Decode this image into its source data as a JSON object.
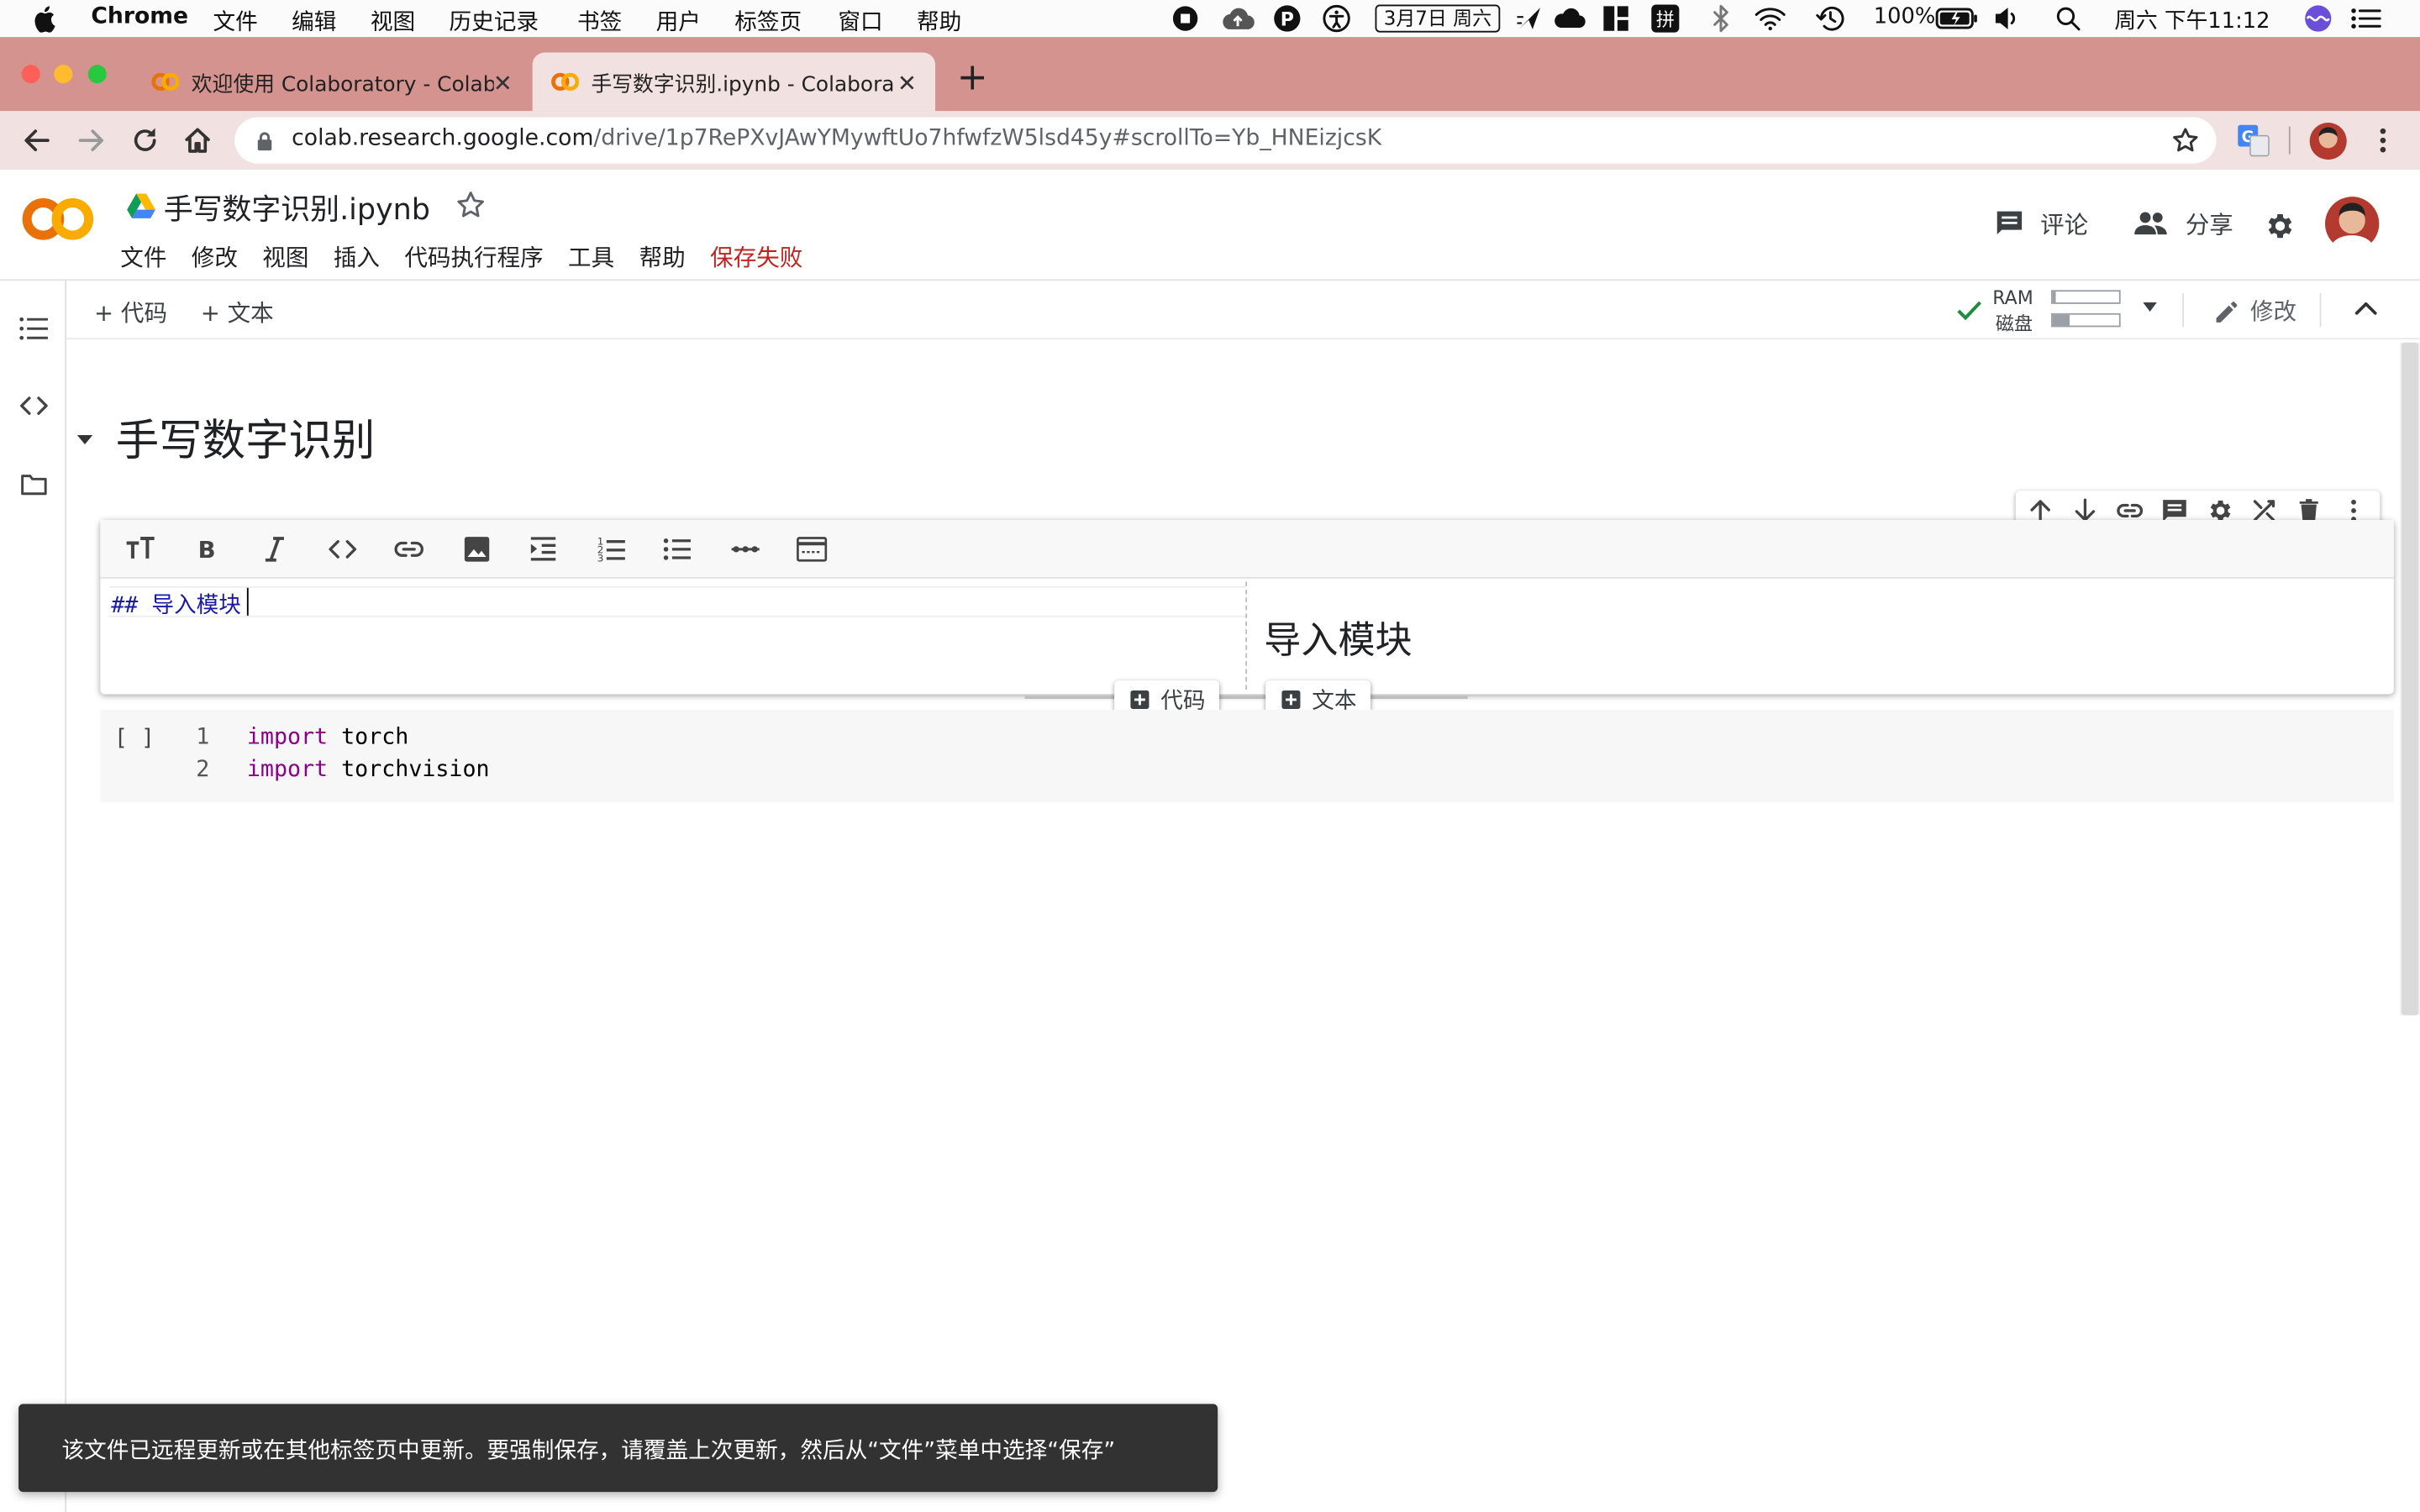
{
  "macos_menubar": {
    "app_name": "Chrome",
    "menus": [
      "文件",
      "编辑",
      "视图",
      "历史记录",
      "书签",
      "用户",
      "标签页",
      "窗口",
      "帮助"
    ],
    "date_badge": "3月7日 周六",
    "battery": "100%",
    "clock": "周六 下午11:12"
  },
  "browser": {
    "tabs": [
      {
        "title": "欢迎使用 Colaboratory - Colabor",
        "active": false
      },
      {
        "title": "手写数字识别.ipynb - Colaborato",
        "active": true
      }
    ],
    "new_tab_symbol": "+",
    "url_host": "colab.research.google.com",
    "url_path": "/drive/1p7RePXvJAwYMywftUo7hfwfzW5lsd45y#scrollTo=Yb_HNEizjcsK"
  },
  "colab": {
    "logo_text": "CO",
    "notebook_title": "手写数字识别.ipynb",
    "menus": [
      "文件",
      "修改",
      "视图",
      "插入",
      "代码执行程序",
      "工具",
      "帮助"
    ],
    "save_status": "保存失败",
    "comment_label": "评论",
    "share_label": "分享",
    "add_code_label": "代码",
    "add_text_label": "文本",
    "ram_label": "RAM",
    "disk_label": "磁盘",
    "edit_label": "修改",
    "ram_fraction": 0.05,
    "disk_fraction": 0.25
  },
  "notebook": {
    "section_title": "手写数字识别",
    "text_cell": {
      "markdown_source": "## 导入模块",
      "preview_heading": "导入模块"
    },
    "inserter": {
      "code_label": "代码",
      "text_label": "文本"
    },
    "code_cell": {
      "run_indicator": "[ ]",
      "lines": [
        {
          "num": "1",
          "keyword": "import",
          "rest": "torch"
        },
        {
          "num": "2",
          "keyword": "import",
          "rest": "torchvision"
        }
      ]
    }
  },
  "toast": {
    "message": "该文件已远程更新或在其他标签页中更新。要强制保存，请覆盖上次更新，然后从“文件”菜单中选择“保存”"
  },
  "colors": {
    "tab_strip": "#d4938f",
    "toolbar": "#f1e1e0",
    "save_fail": "#c5221f",
    "keyword": "#8b008b",
    "markdown": "#1a1aa6",
    "logo_orange": "#f9ab00",
    "logo_dark_orange": "#e8710a",
    "check_green": "#1e8e3e"
  }
}
